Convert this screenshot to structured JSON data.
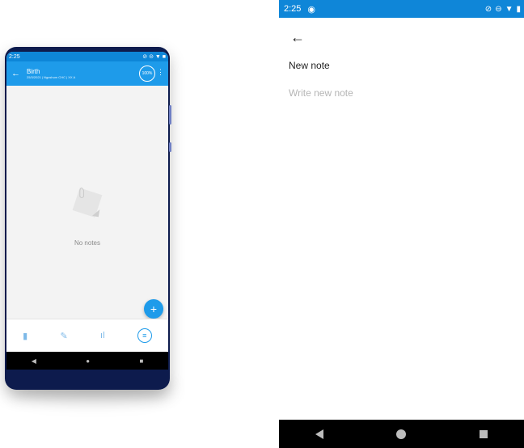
{
  "preview": {
    "status": {
      "time": "2:25"
    },
    "appbar": {
      "title": "Birth",
      "subtitle": "25/3/2021 | Ngoshum CHC | XX A",
      "progress": "100%"
    },
    "empty_text": "No notes",
    "fab": "+"
  },
  "editor": {
    "status": {
      "time": "2:25"
    },
    "title": {
      "value": "New note"
    },
    "body": {
      "placeholder": "Write new note"
    }
  },
  "colors": {
    "primary": "#1e9bea",
    "status": "#0f86d8",
    "phone_frame": "#0d1b4d"
  }
}
